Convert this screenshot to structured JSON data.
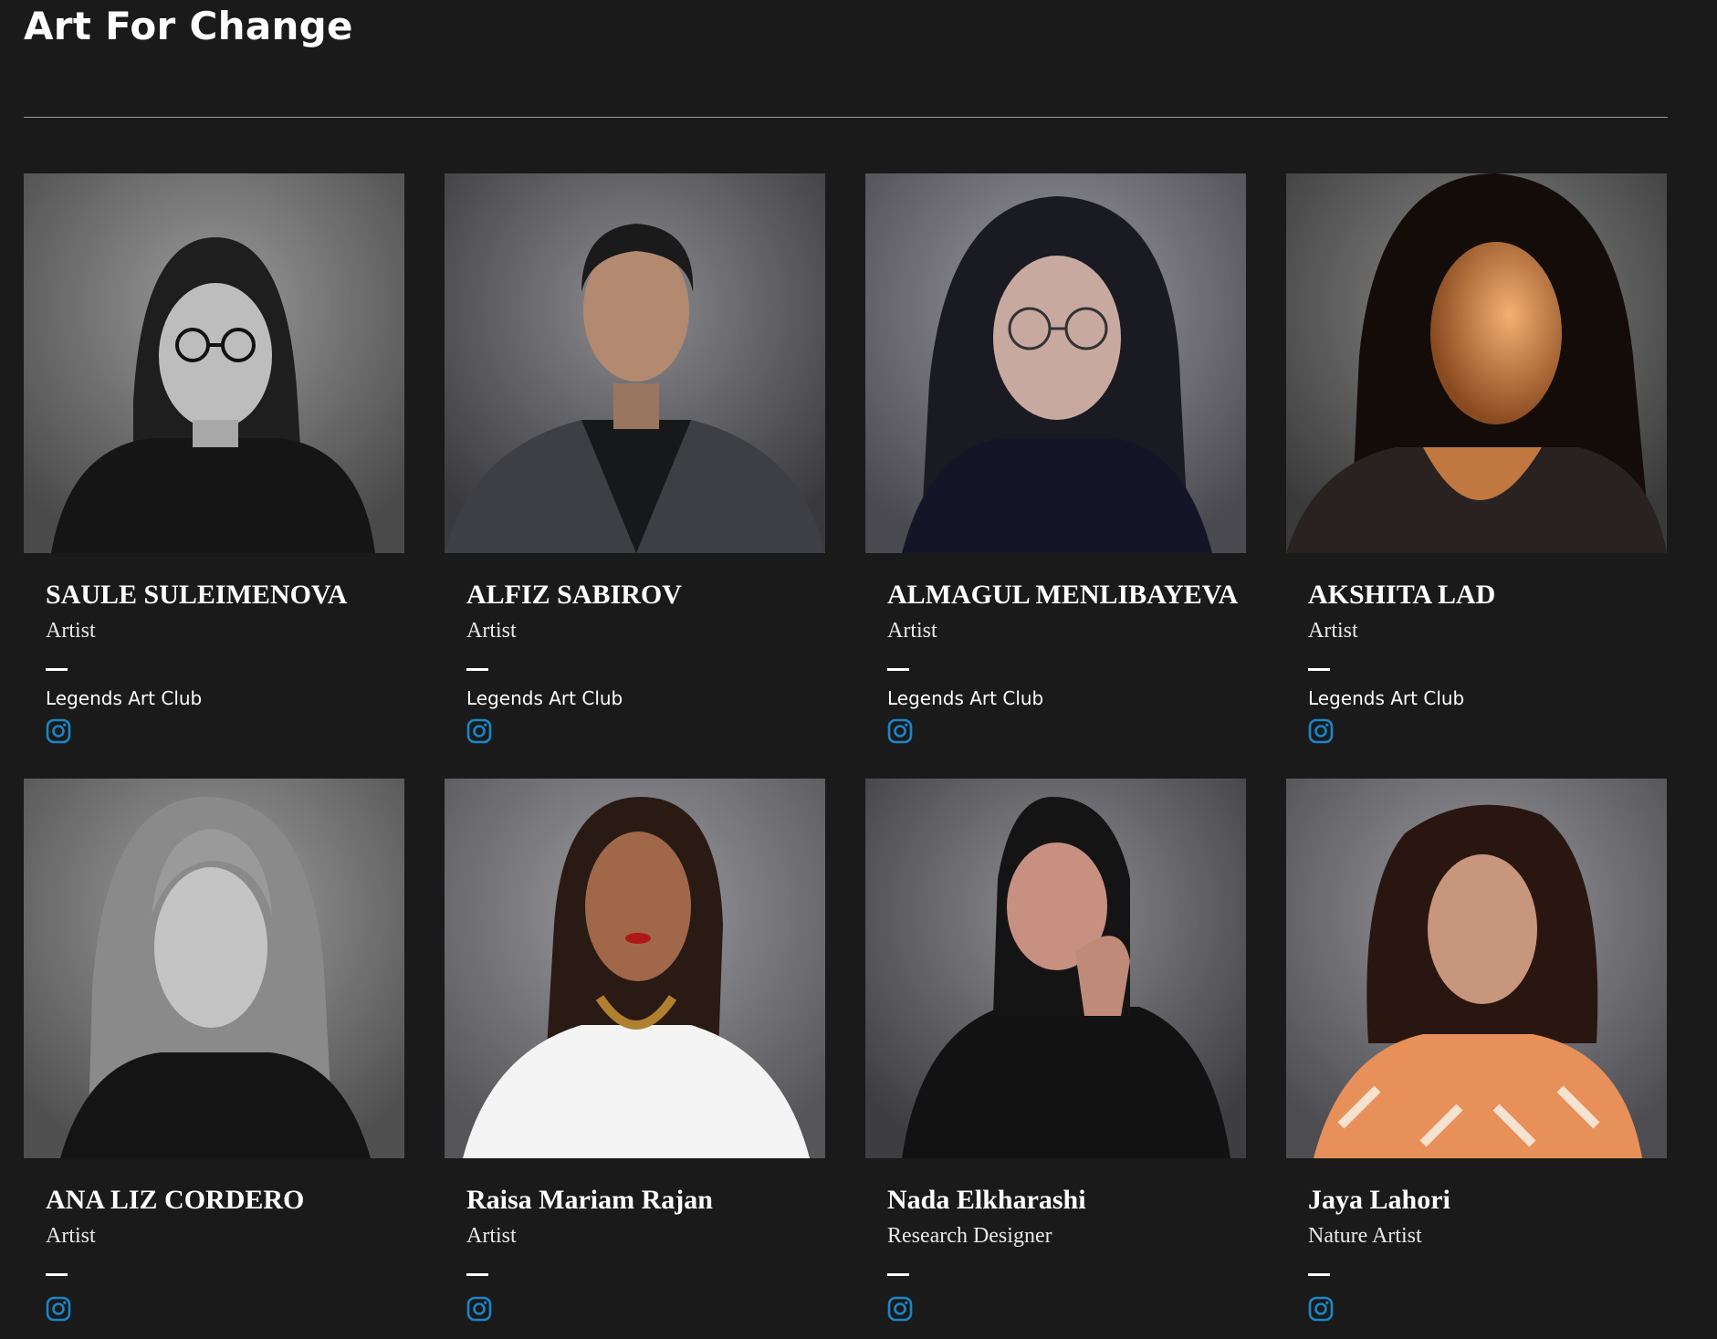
{
  "page": {
    "title": "Art For Change"
  },
  "colors": {
    "background": "#1a1a1a",
    "text": "#ffffff",
    "instagram_icon": "#1a86c8"
  },
  "people": [
    {
      "name": "SAULE SULEIMENOVA",
      "role": "Artist",
      "club": "Legends Art Club",
      "icon": "instagram-icon",
      "photo_tone": "grayscale"
    },
    {
      "name": "ALFIZ SABIROV",
      "role": "Artist",
      "club": "Legends Art Club",
      "icon": "instagram-icon",
      "photo_tone": "color"
    },
    {
      "name": "ALMAGUL MENLIBAYEVA",
      "role": "Artist",
      "club": "Legends Art Club",
      "icon": "instagram-icon",
      "photo_tone": "color"
    },
    {
      "name": "AKSHITA LAD",
      "role": "Artist",
      "club": "Legends Art Club",
      "icon": "instagram-icon",
      "photo_tone": "warm"
    },
    {
      "name": "ANA LIZ CORDERO",
      "role": "Artist",
      "icon": "instagram-icon",
      "photo_tone": "grayscale"
    },
    {
      "name": "Raisa Mariam Rajan",
      "role": "Artist",
      "icon": "instagram-icon",
      "photo_tone": "color"
    },
    {
      "name": "Nada Elkharashi",
      "role": "Research Designer",
      "icon": "instagram-icon",
      "photo_tone": "color"
    },
    {
      "name": "Jaya Lahori",
      "role": "Nature Artist",
      "icon": "instagram-icon",
      "photo_tone": "color"
    }
  ]
}
